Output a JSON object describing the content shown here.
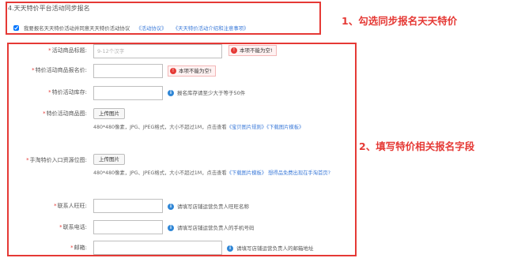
{
  "section": {
    "title": "4.天天特价平台活动同步报名",
    "agree_text": "我要报名天天特价活动并同意天天特价活动协议",
    "link_agreement": "《活动协议》",
    "link_intro": "《天天特价活动介绍和注意事项》"
  },
  "steps": {
    "step1": "1、勾选同步报名天天特价",
    "step2": "2、填写特价相关报名字段"
  },
  "form": {
    "product_title": {
      "label": "活动商品标题:",
      "placeholder": "9-12个汉字",
      "error": "本项不能为空!"
    },
    "product_price": {
      "label": "特价活动商品报名价:",
      "error": "本项不能为空!"
    },
    "stock": {
      "label": "特价活动库存:",
      "hint": "报名库存请至少大于等于50件"
    },
    "product_image": {
      "label": "特价活动商品图:",
      "button": "上传图片",
      "hint_prefix": "480*480像素，JPG、JPEG格式，大小不超过1M，点击查看",
      "hint_link1": "《宝贝图片规则》",
      "hint_link2": "《下载图片模板》"
    },
    "entry_image": {
      "label": "手淘特价入口资源位图:",
      "button": "上传图片",
      "hint_prefix": "480*480像素，JPG、JPEG格式，大小不超过1M，点击查看",
      "hint_link1": "《下载图片模板》",
      "hint_link2": "想得品免费出现在手淘首页?"
    },
    "contact_wangwang": {
      "label": "联系人旺旺:",
      "hint": "请填写店铺运营负责人旺旺名称"
    },
    "contact_phone": {
      "label": "联系电话:",
      "hint": "请填写店铺运营负责人的手机号码"
    },
    "email": {
      "label": "邮箱:",
      "hint": "请填写店铺运营负责人的邮箱地址"
    }
  },
  "icons": {
    "error": "!",
    "info": "i"
  },
  "colors": {
    "highlight_red": "#e53935",
    "link_blue": "#3d7bd9",
    "info_blue": "#2f86d6"
  }
}
